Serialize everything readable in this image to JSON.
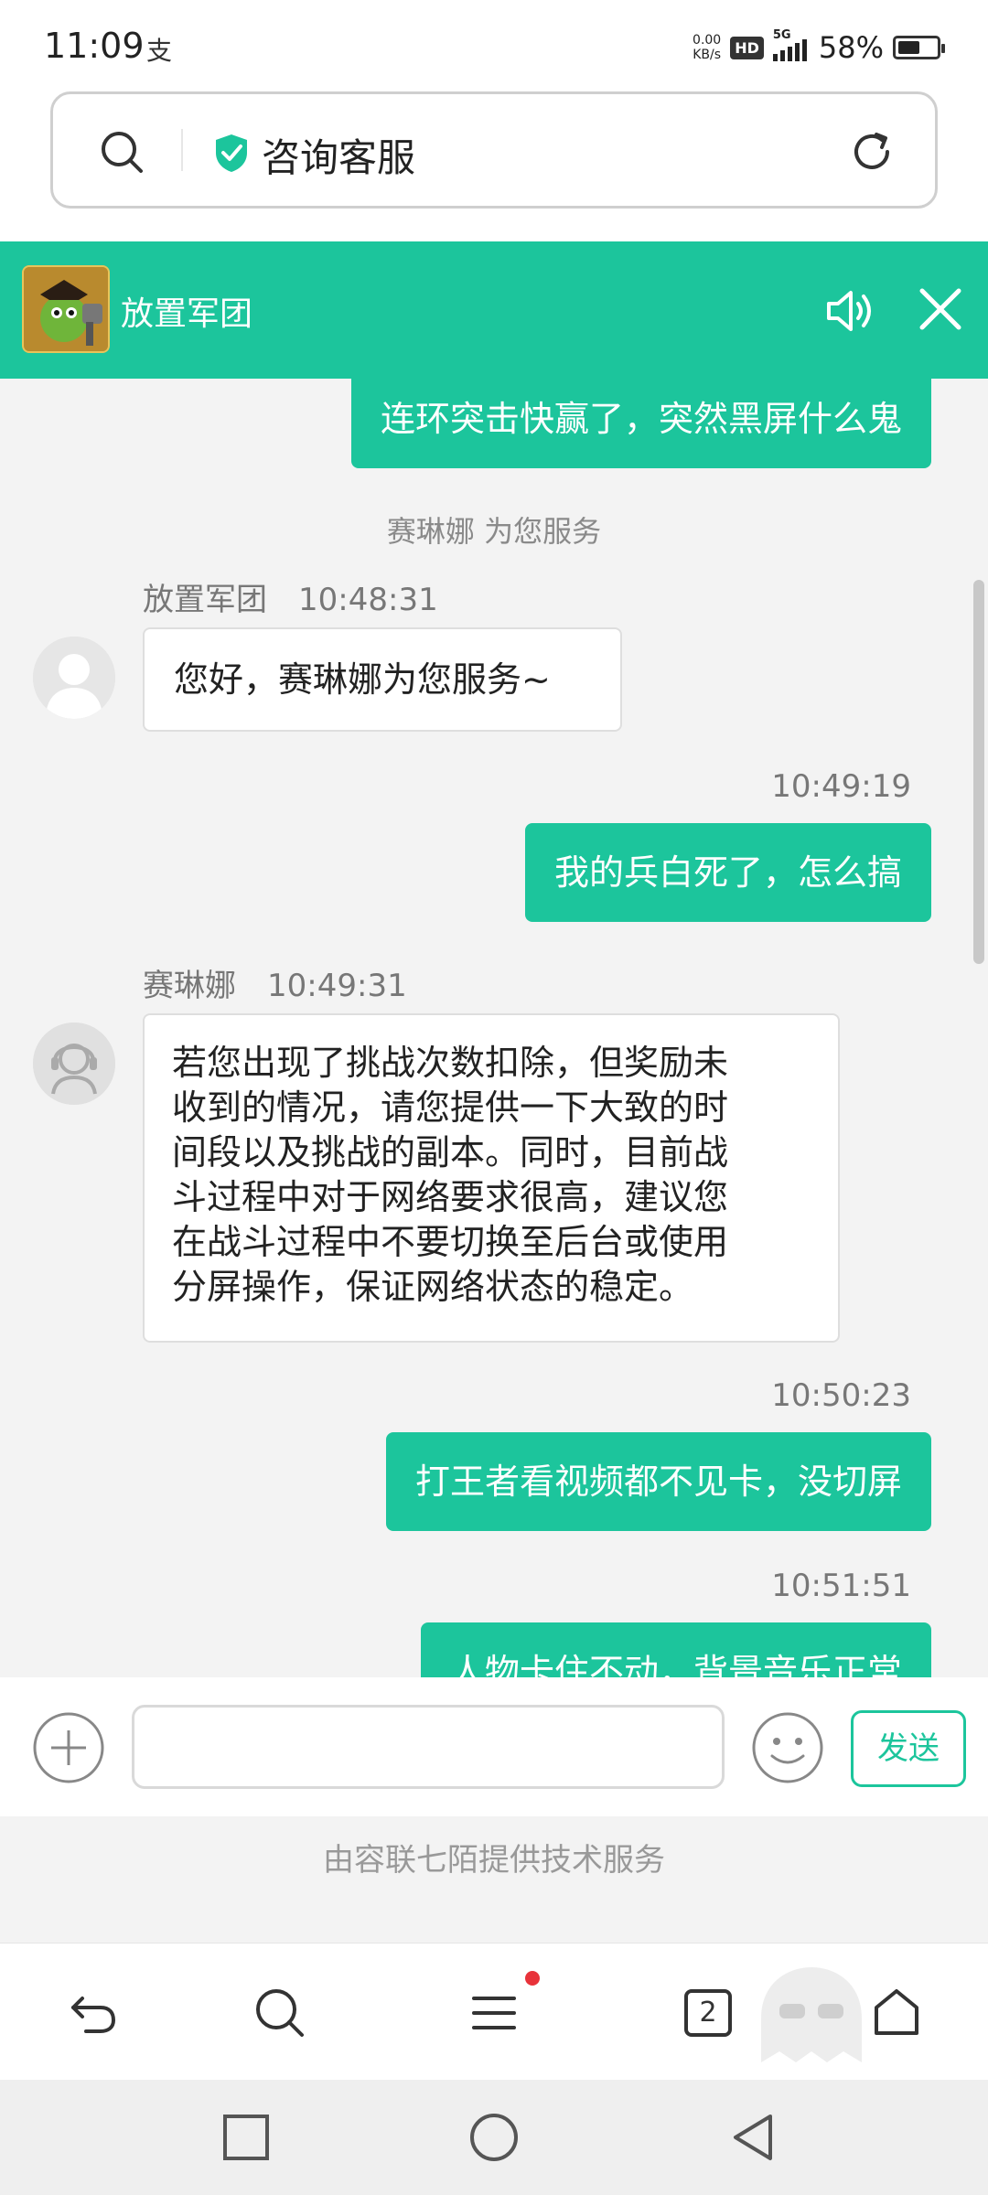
{
  "status_bar": {
    "time": "11:09",
    "alipay_glyph": "支",
    "net_speed_value": "0.00",
    "net_speed_unit": "KB/s",
    "hd": "HD",
    "signal_label": "5G",
    "battery_percent": "58%",
    "battery_level": 0.58
  },
  "url_bar": {
    "title": "咨询客服",
    "icons": [
      "search-icon",
      "shield-check-icon",
      "reload-icon"
    ],
    "shield_color": "#1cc59c"
  },
  "chat_header": {
    "app_name": "放置军团",
    "icons": [
      "speaker-icon",
      "close-icon"
    ],
    "bg_color": "#1cc59c"
  },
  "messages": {
    "m1_out": "连环突击快赢了，突然黑屏什么鬼",
    "system_note": "赛琳娜 为您服务",
    "m2_sender": "放置军团",
    "m2_time": "10:48:31",
    "m2_text": "您好，赛琳娜为您服务~",
    "m3_time": "10:49:19",
    "m3_out": "我的兵白死了，怎么搞",
    "m4_sender": "赛琳娜",
    "m4_time": "10:49:31",
    "m4_lines": [
      "若您出现了挑战次数扣除，但奖励未",
      "收到的情况，请您提供一下大致的时",
      "间段以及挑战的副本。同时，目前战",
      "斗过程中对于网络要求很高，建议您",
      "在战斗过程中不要切换至后台或使用",
      "分屏操作，保证网络状态的稳定。"
    ],
    "m5_time": "10:50:23",
    "m5_out": "打王者看视频都不见卡，没切屏",
    "m6_time": "10:51:51",
    "m6_out": "人物卡住不动，背景音乐正常"
  },
  "input_bar": {
    "placeholder": "",
    "send_label": "发送",
    "icons": [
      "plus-icon",
      "emoji-icon"
    ]
  },
  "powered_by": "由容联七陌提供技术服务",
  "browser_toolbar": {
    "tab_count": "2",
    "icons": [
      "back-icon",
      "search-icon",
      "menu-icon",
      "tabs-icon",
      "home-icon"
    ],
    "menu_badge_color": "#e8333a"
  },
  "system_nav": {
    "icons": [
      "recent-apps-icon",
      "home-circle-icon",
      "back-triangle-icon"
    ]
  }
}
